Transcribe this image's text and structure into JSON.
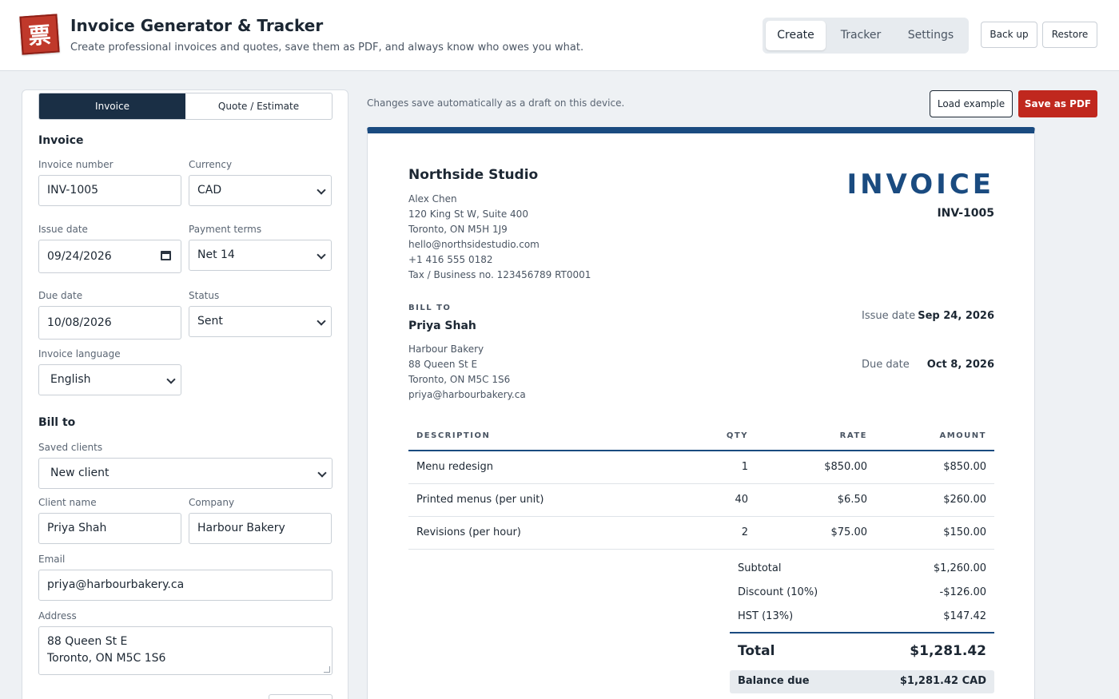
{
  "header": {
    "logo_glyph": "票",
    "title": "Invoice Generator & Tracker",
    "subtitle": "Create professional invoices and quotes, save them as PDF, and always know who owes you what.",
    "tabs": [
      {
        "label": "Create",
        "active": true
      },
      {
        "label": "Tracker",
        "active": false
      },
      {
        "label": "Settings",
        "active": false
      }
    ],
    "backup_label": "Back up",
    "restore_label": "Restore"
  },
  "form": {
    "doc_types": [
      {
        "label": "Invoice",
        "active": true
      },
      {
        "label": "Quote / Estimate",
        "active": false
      }
    ],
    "section_invoice": "Invoice",
    "invoice_number": {
      "label": "Invoice number",
      "value": "INV-1005"
    },
    "currency": {
      "label": "Currency",
      "value": "CAD"
    },
    "issue_date": {
      "label": "Issue date",
      "value": "09/24/2026"
    },
    "payment_terms": {
      "label": "Payment terms",
      "value": "Net 14"
    },
    "due_date": {
      "label": "Due date",
      "value": "10/08/2026"
    },
    "status": {
      "label": "Status",
      "value": "Sent"
    },
    "language": {
      "label": "Invoice language",
      "value": "English"
    },
    "section_billto": "Bill to",
    "saved_clients": {
      "label": "Saved clients",
      "value": "New client"
    },
    "client_name": {
      "label": "Client name",
      "value": "Priya Shah"
    },
    "company": {
      "label": "Company",
      "value": "Harbour Bakery"
    },
    "email": {
      "label": "Email",
      "value": "priya@harbourbakery.ca"
    },
    "address": {
      "label": "Address",
      "value": "88 Queen St E\nToronto, ON M5C 1S6"
    }
  },
  "toolbar": {
    "autosave_note": "Changes save automatically as a draft on this device.",
    "load_example_label": "Load example",
    "save_pdf_label": "Save as PDF"
  },
  "preview": {
    "accent_color": "#1a4b80",
    "seller": {
      "name": "Northside Studio",
      "lines": [
        "Alex Chen",
        "120 King St W, Suite 400",
        "Toronto, ON M5H 1J9",
        "hello@northsidestudio.com",
        "+1 416 555 0182",
        "Tax / Business no. 123456789 RT0001"
      ]
    },
    "doc_heading": "INVOICE",
    "doc_number": "INV-1005",
    "bill_to_label": "BILL TO",
    "client": {
      "name": "Priya Shah",
      "lines": [
        "Harbour Bakery",
        "88 Queen St E",
        "Toronto, ON M5C 1S6",
        "priya@harbourbakery.ca"
      ]
    },
    "issue_date_label": "Issue date",
    "issue_date": "Sep 24, 2026",
    "due_date_label": "Due date",
    "due_date": "Oct 8, 2026",
    "columns": {
      "description": "DESCRIPTION",
      "qty": "QTY",
      "rate": "RATE",
      "amount": "AMOUNT"
    },
    "items": [
      {
        "description": "Menu redesign",
        "qty": "1",
        "rate": "$850.00",
        "amount": "$850.00"
      },
      {
        "description": "Printed menus (per unit)",
        "qty": "40",
        "rate": "$6.50",
        "amount": "$260.00"
      },
      {
        "description": "Revisions (per hour)",
        "qty": "2",
        "rate": "$75.00",
        "amount": "$150.00"
      }
    ],
    "totals": {
      "subtotal_label": "Subtotal",
      "subtotal": "$1,260.00",
      "discount_label": "Discount (10%)",
      "discount": "-$126.00",
      "tax_label": "HST (13%)",
      "tax": "$147.42",
      "total_label": "Total",
      "total": "$1,281.42",
      "balance_label": "Balance due",
      "balance": "$1,281.42 CAD"
    }
  }
}
